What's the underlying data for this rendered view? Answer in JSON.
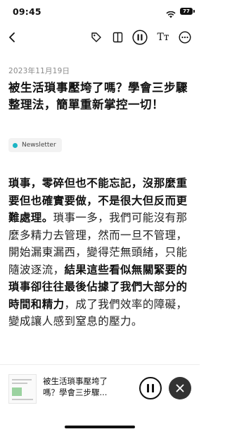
{
  "status_bar": {
    "time": "09:45",
    "battery": "77"
  },
  "toolbar": {
    "font_label": "Tт"
  },
  "article": {
    "date": "2023年11月19日",
    "title": "被生活瑣事壓垮了嗎？學會三步驟整理法，簡單重新掌控一切！",
    "tag": "Newsletter",
    "tag_color": "#1bb4c4",
    "body_bold_1": "瑣事，零碎但也不能忘記，沒那麼重要但也確實要做，不是很大但反而更難處理。",
    "body_normal_1": "瑣事一多，我們可能沒有那麼多精力去管理，然而一旦不管理，開始漏東漏西，變得茫無頭緒，只能隨波逐流，",
    "body_bold_2": "結果這些看似無關緊要的瑣事卻往往最後佔據了我們大部分的時間和精力",
    "body_normal_2": "，成了我們效率的障礙，變成讓人感到窒息的壓力。"
  },
  "player": {
    "title_line_1": "被生活瑣事壓垮了",
    "title_line_2": "嗎？學會三步驟..."
  }
}
